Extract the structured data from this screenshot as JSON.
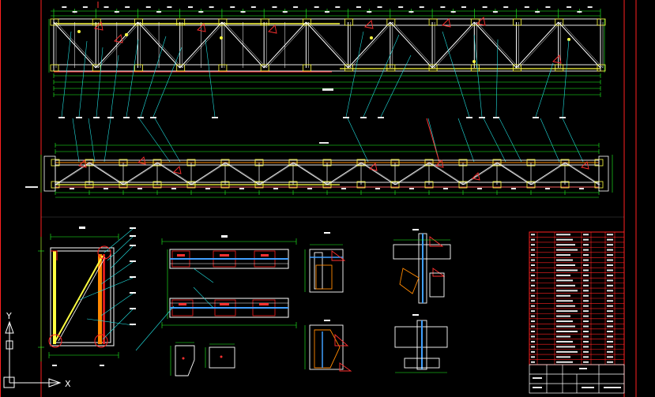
{
  "ucs": {
    "x_label": "X",
    "y_label": "Y"
  },
  "colors": {
    "background": "#000000",
    "border": "#ff2020",
    "dimension": "#20ff20",
    "member": "#ffffff",
    "leader": "#20e0e0",
    "highlight": "#ffff40",
    "annotation": "#ff3030",
    "plate": "#40a0ff"
  },
  "icons": {
    "ucs": "ucs-axis-icon"
  }
}
